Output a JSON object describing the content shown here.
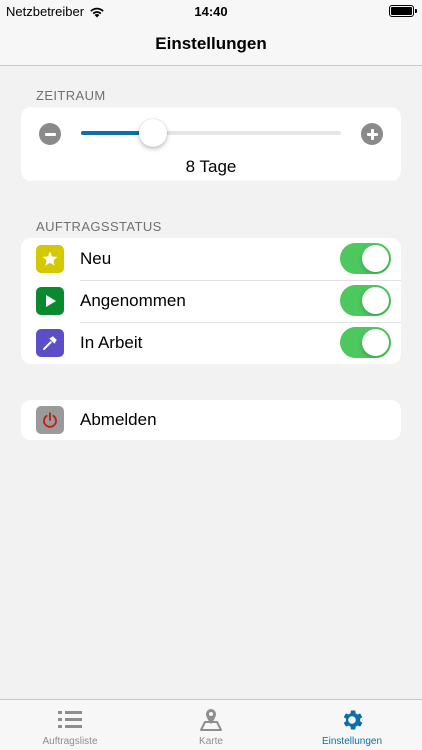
{
  "status_bar": {
    "carrier": "Netzbetreiber",
    "time": "14:40"
  },
  "nav": {
    "title": "Einstellungen"
  },
  "zeitraum": {
    "header": "ZEITRAUM",
    "value_label": "8 Tage",
    "slider_fraction": 0.27
  },
  "auftragsstatus": {
    "header": "AUFTRAGSSTATUS",
    "items": [
      {
        "label": "Neu",
        "icon": "star-icon",
        "color": "#d4c800",
        "enabled": true
      },
      {
        "label": "Angenommen",
        "icon": "play-icon",
        "color": "#0a8a2e",
        "enabled": true
      },
      {
        "label": "In Arbeit",
        "icon": "hammer-icon",
        "color": "#5a4fc8",
        "enabled": true
      }
    ]
  },
  "logout": {
    "label": "Abmelden",
    "icon": "power-icon",
    "color": "#9a9a9a"
  },
  "colors": {
    "accent": "#0f6ea6",
    "toggle_on": "#4cc85e",
    "tab_inactive": "#8e8e8e"
  },
  "tabs": [
    {
      "label": "Auftragsliste",
      "icon": "list-icon",
      "active": false
    },
    {
      "label": "Karte",
      "icon": "map-icon",
      "active": false
    },
    {
      "label": "Einstellungen",
      "icon": "gear-icon",
      "active": true
    }
  ]
}
